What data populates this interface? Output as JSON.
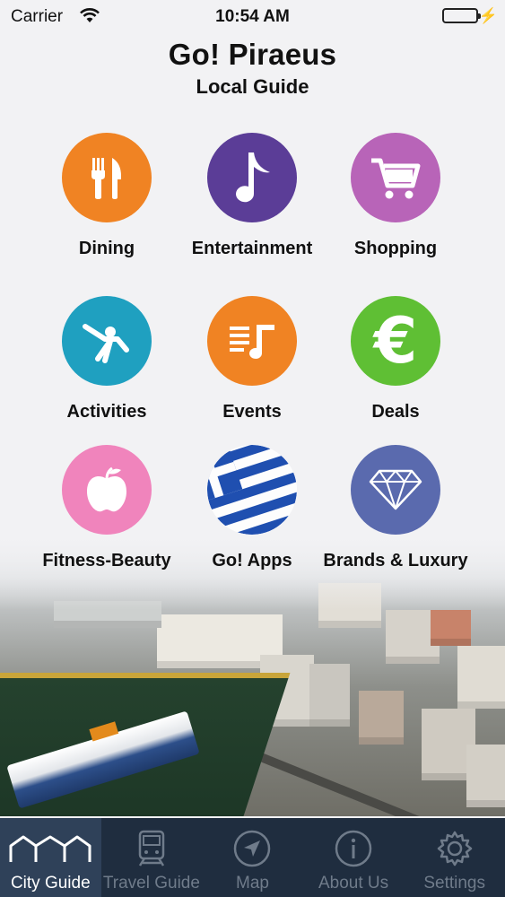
{
  "status_bar": {
    "carrier": "Carrier",
    "time": "10:54 AM"
  },
  "header": {
    "title": "Go! Piraeus",
    "subtitle": "Local Guide"
  },
  "categories": [
    {
      "label": "Dining",
      "icon": "fork-knife-icon",
      "color": "#f08323"
    },
    {
      "label": "Entertainment",
      "icon": "music-note-icon",
      "color": "#5b3d97"
    },
    {
      "label": "Shopping",
      "icon": "shopping-cart-icon",
      "color": "#b864b8"
    },
    {
      "label": "Activities",
      "icon": "stretching-person-icon",
      "color": "#1fa0c0"
    },
    {
      "label": "Events",
      "icon": "music-list-icon",
      "color": "#f08323"
    },
    {
      "label": "Deals",
      "icon": "euro-icon",
      "color": "#5fbf34"
    },
    {
      "label": "Fitness-Beauty",
      "icon": "apple-icon",
      "color": "#f084bc"
    },
    {
      "label": "Go! Apps",
      "icon": "greek-flag-icon",
      "color": "#1f4fb0"
    },
    {
      "label": "Brands & Luxury",
      "icon": "diamond-icon",
      "color": "#5a6aae"
    }
  ],
  "tabbar": {
    "tabs": [
      {
        "label": "City Guide",
        "icon": "city-skyline-icon",
        "active": true
      },
      {
        "label": "Travel Guide",
        "icon": "train-icon",
        "active": false
      },
      {
        "label": "Map",
        "icon": "navigation-arrow-icon",
        "active": false
      },
      {
        "label": "About Us",
        "icon": "info-icon",
        "active": false
      },
      {
        "label": "Settings",
        "icon": "gear-icon",
        "active": false
      }
    ]
  }
}
